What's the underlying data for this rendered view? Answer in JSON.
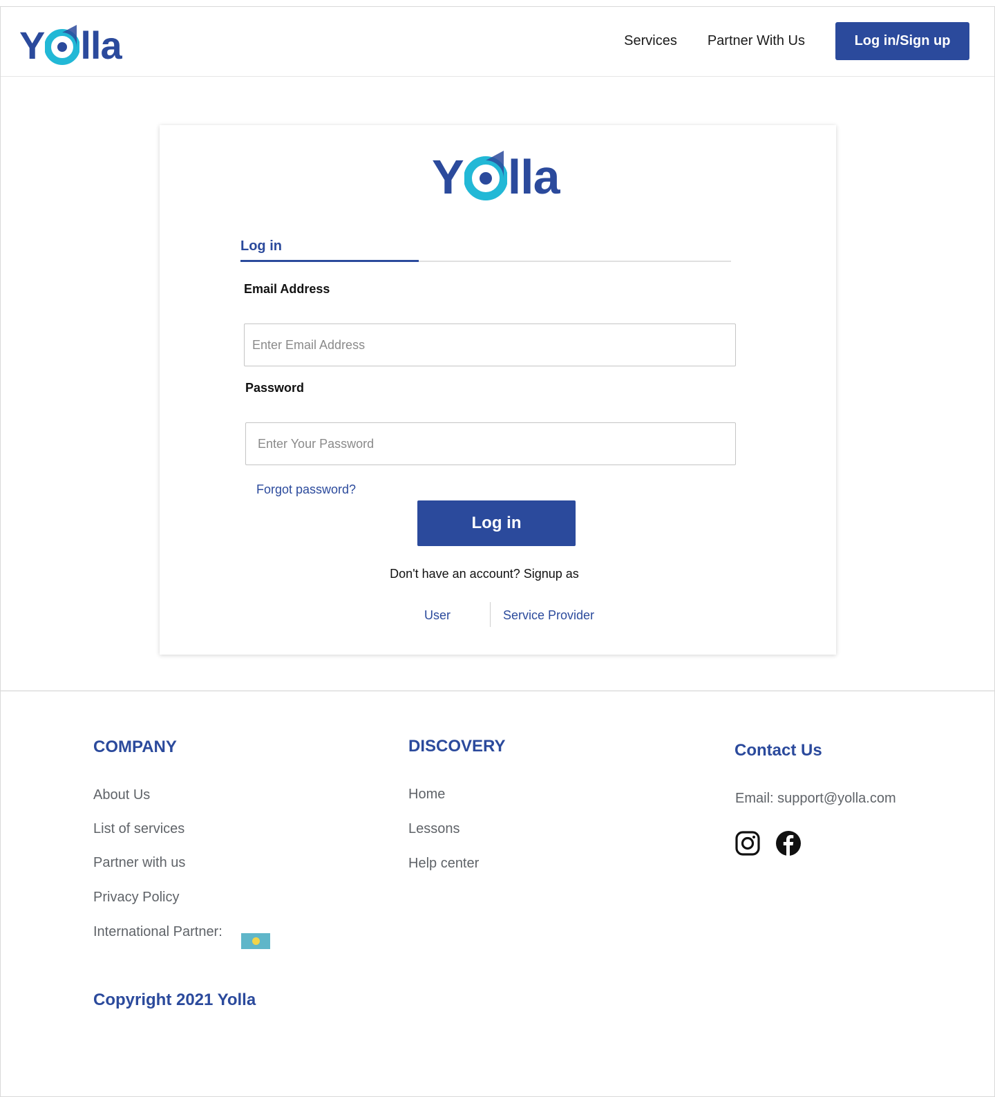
{
  "header": {
    "logo": {
      "text_y": "Y",
      "text_rest": "lla"
    },
    "nav": [
      {
        "label": "Services"
      },
      {
        "label": "Partner With Us"
      }
    ],
    "cta_label": "Log in/Sign up"
  },
  "card": {
    "logo": {
      "text_y": "Y",
      "text_rest": "lla"
    },
    "tab_label": "Log in",
    "email_label": "Email Address",
    "email_placeholder": "Enter Email Address",
    "email_value": "",
    "password_label": "Password",
    "password_placeholder": "Enter Your Password",
    "password_value": "",
    "forgot_label": "Forgot password?",
    "login_label": "Log in",
    "signup_prompt": "Don't have an account? Signup as",
    "signup_user": "User",
    "signup_provider": "Service Provider"
  },
  "footer": {
    "company": {
      "heading": "COMPANY",
      "links": [
        {
          "label": "About Us"
        },
        {
          "label": "List of services"
        },
        {
          "label": "Partner with us"
        },
        {
          "label": "Privacy Policy"
        },
        {
          "label": "International Partner:"
        }
      ]
    },
    "discovery": {
      "heading": "DISCOVERY",
      "links": [
        {
          "label": "Home"
        },
        {
          "label": "Lessons"
        },
        {
          "label": "Help center"
        }
      ]
    },
    "contact": {
      "heading": "Contact Us",
      "email": "Email: support@yolla.com",
      "socials": [
        {
          "icon": "instagram-icon"
        },
        {
          "icon": "facebook-icon"
        }
      ]
    },
    "copyright": "Copyright 2021 Yolla"
  },
  "colors": {
    "brand": "#2b4a9c",
    "accent_teal": "#22b8d6",
    "text_muted": "#5f6368"
  }
}
